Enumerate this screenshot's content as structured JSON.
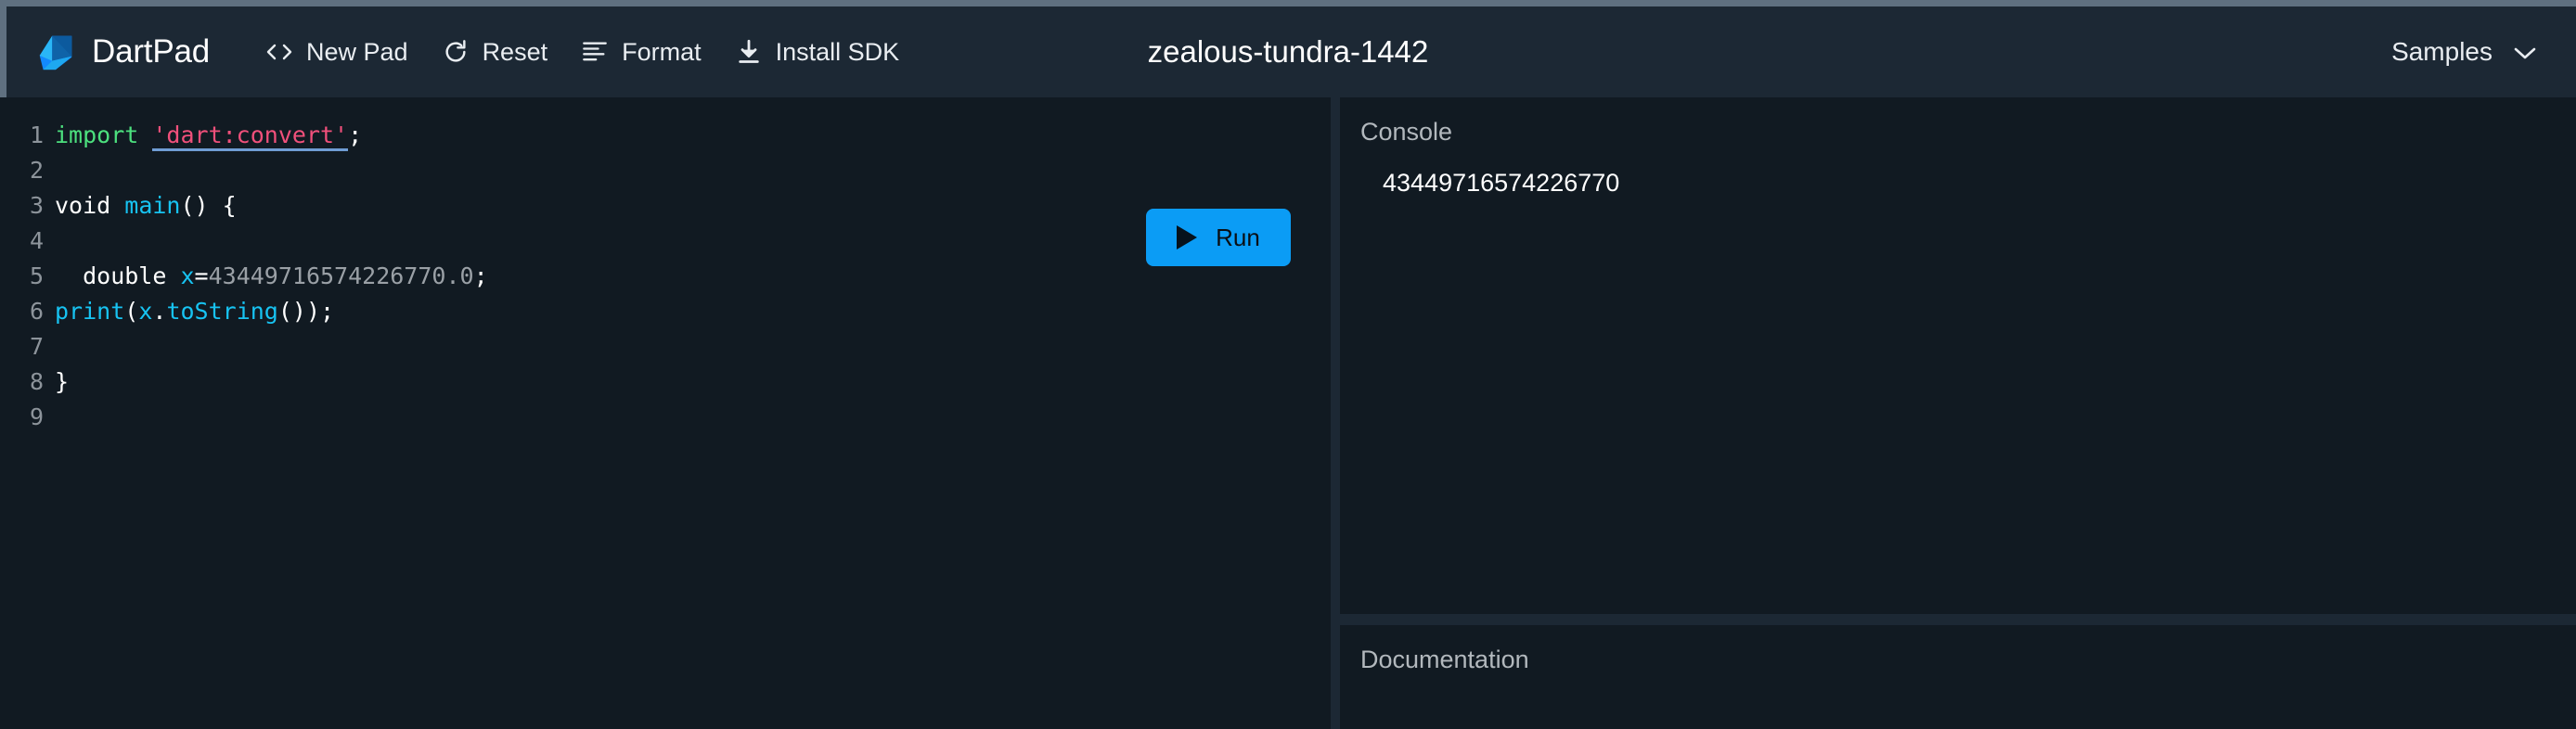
{
  "app": {
    "brand": "DartPad",
    "logo_icon": "dart-logo-icon",
    "pad_title": "zealous-tundra-1442"
  },
  "toolbar": {
    "buttons": [
      {
        "label": "New Pad",
        "icon": "code-brackets-icon"
      },
      {
        "label": "Reset",
        "icon": "refresh-icon"
      },
      {
        "label": "Format",
        "icon": "format-align-left-icon"
      },
      {
        "label": "Install SDK",
        "icon": "download-icon"
      }
    ],
    "samples": {
      "label": "Samples",
      "icon": "chevron-down-icon"
    }
  },
  "editor": {
    "run_button": {
      "label": "Run",
      "icon": "play-triangle-icon"
    },
    "lines": [
      {
        "n": "1",
        "tokens": [
          {
            "t": "import",
            "c": "tok-kw"
          },
          {
            "t": " ",
            "c": "tok-plain"
          },
          {
            "t": "'dart:convert'",
            "c": "tok-str"
          },
          {
            "t": ";",
            "c": "tok-punct"
          }
        ]
      },
      {
        "n": "2",
        "tokens": []
      },
      {
        "n": "3",
        "tokens": [
          {
            "t": "void ",
            "c": "tok-plain"
          },
          {
            "t": "main",
            "c": "tok-fn"
          },
          {
            "t": "() {",
            "c": "tok-punct"
          }
        ]
      },
      {
        "n": "4",
        "tokens": []
      },
      {
        "n": "5",
        "tokens": [
          {
            "t": "  double ",
            "c": "tok-plain"
          },
          {
            "t": "x",
            "c": "tok-var"
          },
          {
            "t": "=",
            "c": "tok-plain"
          },
          {
            "t": "43449716574226770.0",
            "c": "tok-num"
          },
          {
            "t": ";",
            "c": "tok-punct"
          }
        ]
      },
      {
        "n": "6",
        "tokens": [
          {
            "t": "print",
            "c": "tok-fn"
          },
          {
            "t": "(",
            "c": "tok-punct"
          },
          {
            "t": "x",
            "c": "tok-var"
          },
          {
            "t": ".",
            "c": "tok-punct"
          },
          {
            "t": "toString",
            "c": "tok-fn"
          },
          {
            "t": "());",
            "c": "tok-punct"
          }
        ]
      },
      {
        "n": "7",
        "tokens": []
      },
      {
        "n": "8",
        "tokens": [
          {
            "t": "}",
            "c": "tok-punct"
          }
        ]
      },
      {
        "n": "9",
        "tokens": []
      }
    ]
  },
  "console": {
    "title": "Console",
    "output": "43449716574226770"
  },
  "documentation": {
    "title": "Documentation",
    "content": ""
  },
  "colors": {
    "accent_run": "#0b9cf5",
    "toolbar_bg": "#1c2834",
    "panel_bg": "#111a22",
    "page_bg": "#0f171e",
    "keyword_green": "#4ce07e",
    "string_pink": "#f1507b",
    "identifier_cyan": "#17c3f2",
    "number_grey": "#9aa0a6"
  }
}
